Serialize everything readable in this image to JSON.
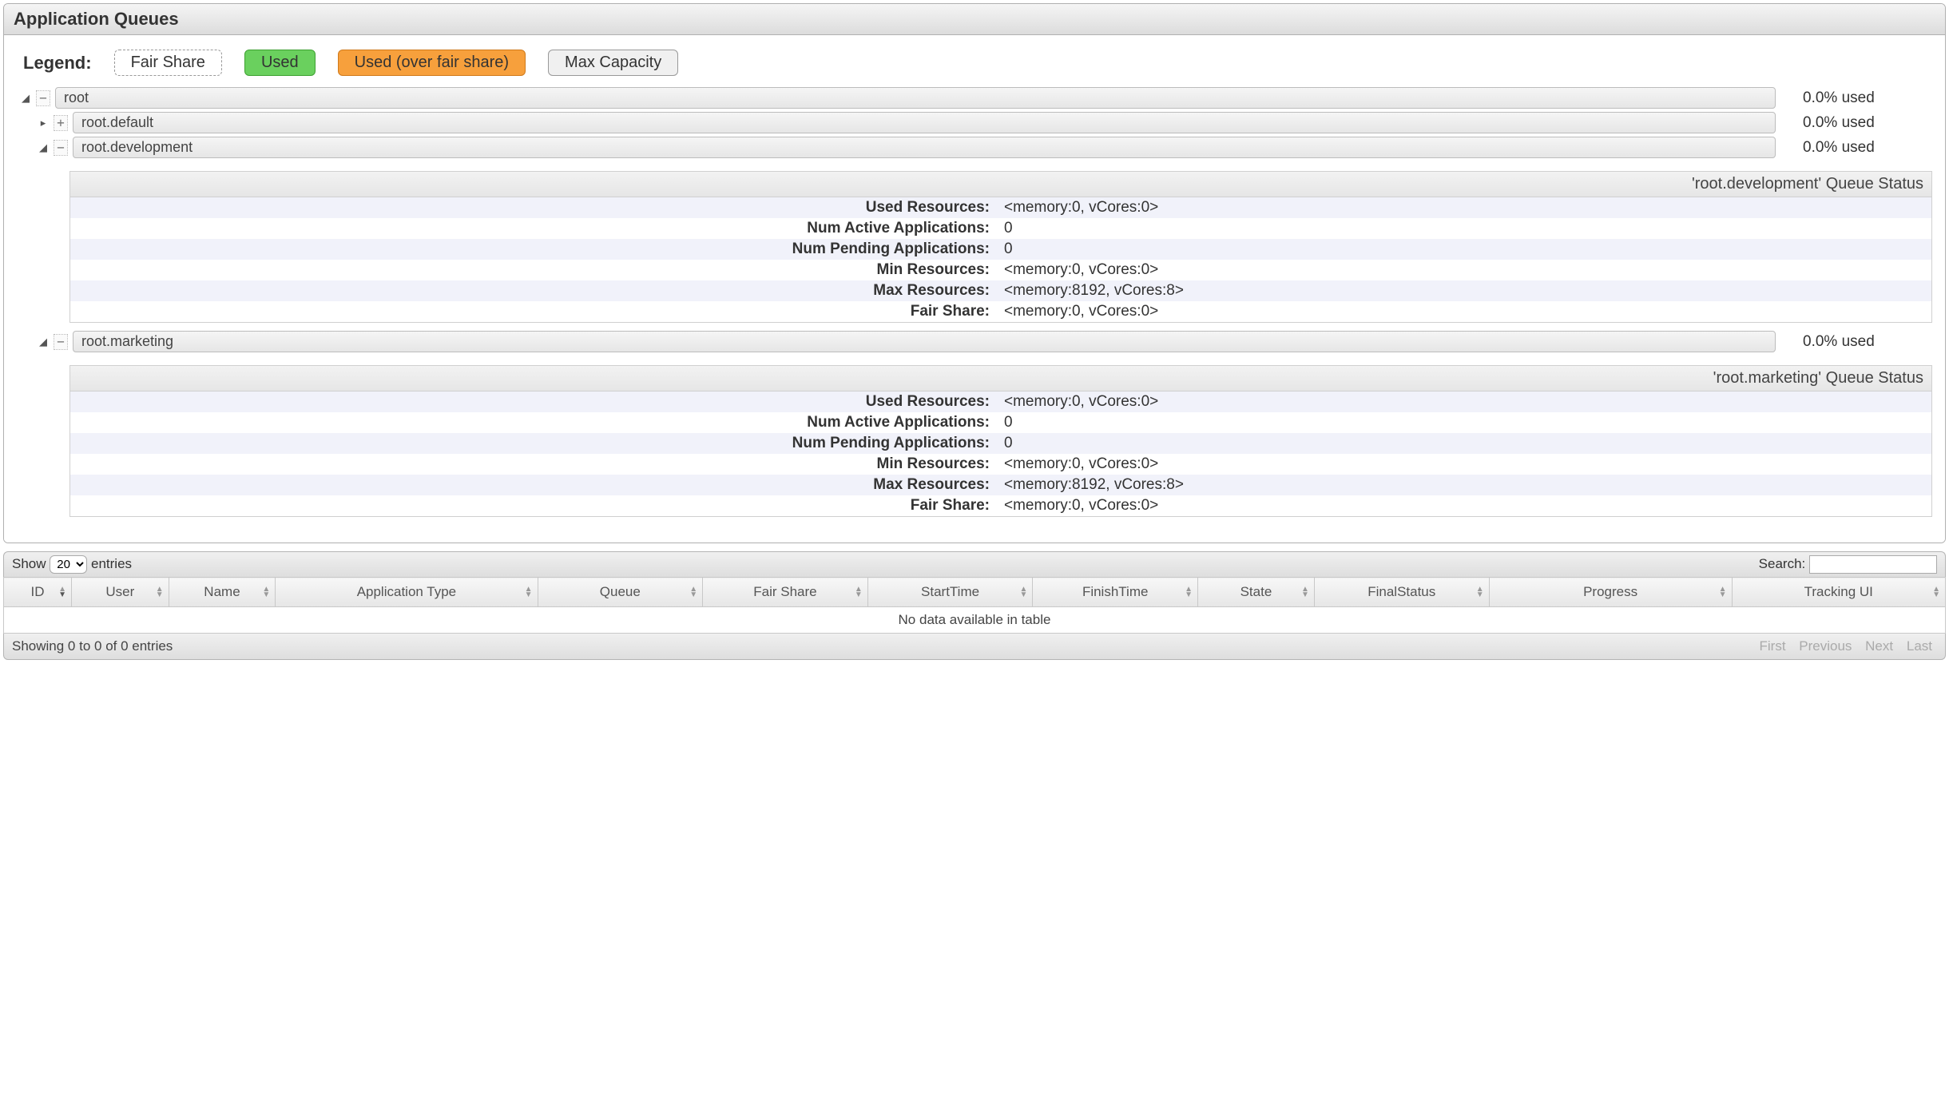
{
  "panel_title": "Application Queues",
  "legend": {
    "label": "Legend:",
    "fair_share": "Fair Share",
    "used": "Used",
    "over_fair": "Used (over fair share)",
    "max_capacity": "Max Capacity"
  },
  "tree": {
    "root": {
      "name": "root",
      "used": "0.0% used"
    },
    "children": [
      {
        "name": "root.default",
        "used": "0.0% used",
        "expanded": false
      },
      {
        "name": "root.development",
        "used": "0.0% used",
        "expanded": true
      },
      {
        "name": "root.marketing",
        "used": "0.0% used",
        "expanded": true
      }
    ]
  },
  "status_panels": [
    {
      "title": "'root.development' Queue Status",
      "rows": [
        {
          "k": "Used Resources:",
          "v": "<memory:0, vCores:0>"
        },
        {
          "k": "Num Active Applications:",
          "v": "0"
        },
        {
          "k": "Num Pending Applications:",
          "v": "0"
        },
        {
          "k": "Min Resources:",
          "v": "<memory:0, vCores:0>"
        },
        {
          "k": "Max Resources:",
          "v": "<memory:8192, vCores:8>"
        },
        {
          "k": "Fair Share:",
          "v": "<memory:0, vCores:0>"
        }
      ]
    },
    {
      "title": "'root.marketing' Queue Status",
      "rows": [
        {
          "k": "Used Resources:",
          "v": "<memory:0, vCores:0>"
        },
        {
          "k": "Num Active Applications:",
          "v": "0"
        },
        {
          "k": "Num Pending Applications:",
          "v": "0"
        },
        {
          "k": "Min Resources:",
          "v": "<memory:0, vCores:0>"
        },
        {
          "k": "Max Resources:",
          "v": "<memory:8192, vCores:8>"
        },
        {
          "k": "Fair Share:",
          "v": "<memory:0, vCores:0>"
        }
      ]
    }
  ],
  "data_table": {
    "show_label_pre": "Show",
    "show_label_post": "entries",
    "show_value": "20",
    "search_label": "Search:",
    "columns": [
      "ID",
      "User",
      "Name",
      "Application Type",
      "Queue",
      "Fair Share",
      "StartTime",
      "FinishTime",
      "State",
      "FinalStatus",
      "Progress",
      "Tracking UI"
    ],
    "no_data": "No data available in table",
    "info": "Showing 0 to 0 of 0 entries",
    "pager": {
      "first": "First",
      "prev": "Previous",
      "next": "Next",
      "last": "Last"
    }
  }
}
